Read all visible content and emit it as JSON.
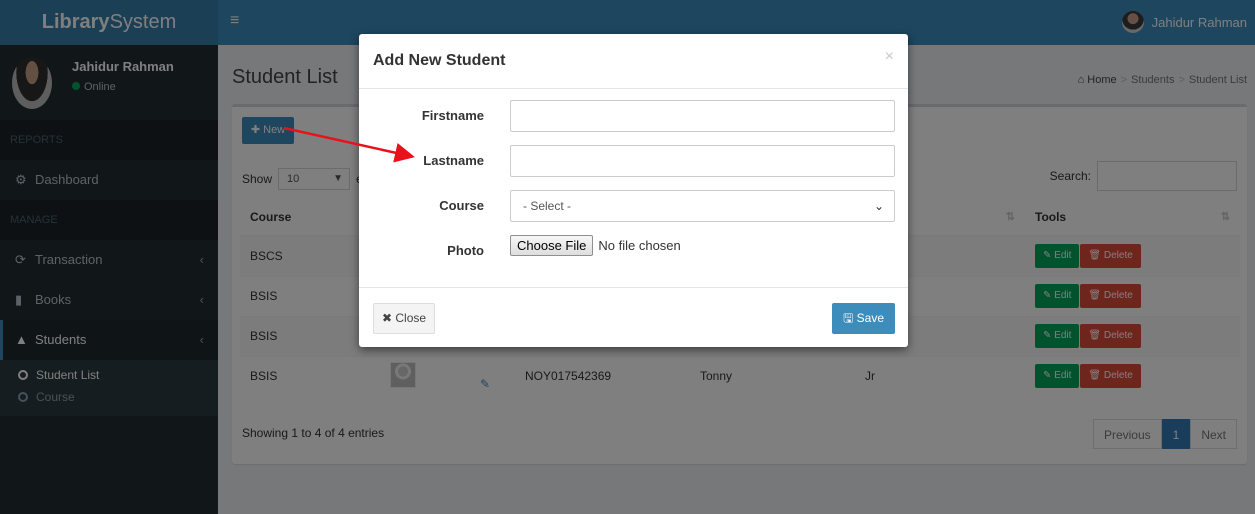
{
  "app": {
    "logo_bold": "Library",
    "logo_rest": "System",
    "toggle_icon": "≡",
    "nav_user": "Jahidur Rahman"
  },
  "sidebar": {
    "user_name": "Jahidur Rahman",
    "user_status": "Online",
    "section_reports": "REPORTS",
    "section_manage": "MANAGE",
    "dashboard": "Dashboard",
    "transaction": "Transaction",
    "books": "Books",
    "students": "Students",
    "sub_student_list": "Student List",
    "sub_course": "Course"
  },
  "page": {
    "title": "Student List",
    "breadcrumb": [
      "Home",
      "Students",
      "Student List"
    ]
  },
  "list": {
    "new_label": "New",
    "show_label": "Show",
    "length_value": "10",
    "entries_label": "en",
    "search_label": "Search:",
    "columns": [
      "Course",
      "Tools"
    ],
    "rows": [
      {
        "course": "BSCS",
        "student_id": "",
        "firstname": "",
        "lastname": ""
      },
      {
        "course": "BSIS",
        "student_id": "",
        "firstname": "",
        "lastname": ""
      },
      {
        "course": "BSIS",
        "student_id": "",
        "firstname": "",
        "lastname": ""
      },
      {
        "course": "BSIS",
        "student_id": "NOY017542369",
        "firstname": "Tonny",
        "lastname": "Jr"
      }
    ],
    "edit_label": "Edit",
    "delete_label": "Delete",
    "info": "Showing 1 to 4 of 4 entries",
    "prev_label": "Previous",
    "page_number": "1",
    "next_label": "Next"
  },
  "modal": {
    "title": "Add New Student",
    "close_x": "×",
    "firstname_label": "Firstname",
    "lastname_label": "Lastname",
    "course_label": "Course",
    "course_value": "- Select -",
    "photo_label": "Photo",
    "choose_file": "Choose File",
    "no_file": "No file chosen",
    "close_label": "Close",
    "save_label": "Save"
  },
  "colors": {
    "primary": "#3c8dbc",
    "sidebar_bg": "#222d32",
    "success": "#00a65a",
    "danger": "#dd4b39",
    "annotation_arrow": "#e8121c"
  }
}
